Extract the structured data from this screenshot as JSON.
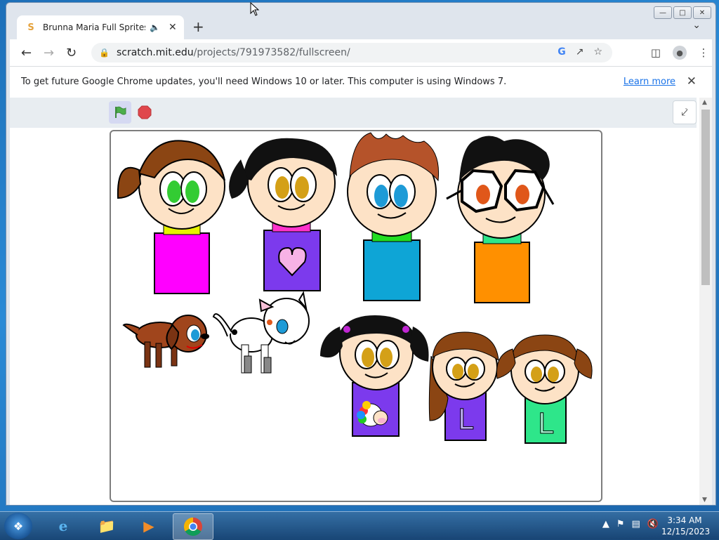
{
  "browser": {
    "tab_title": "Brunna Maria Full Sprites on Scratch",
    "new_tab_glyph": "+",
    "url_host": "scratch.mit.edu",
    "url_path": "/projects/791973582/fullscreen/",
    "infobar_message": "To get future Google Chrome updates, you'll need Windows 10 or later. This computer is using Windows 7.",
    "infobar_link": "Learn more"
  },
  "taskbar": {
    "time": "3:34 AM",
    "date": "12/15/2023"
  },
  "scratch": {
    "sprite_letters": [
      "L",
      "L"
    ]
  },
  "colors": {
    "accent_link": "#1a73e8",
    "flag_green": "#4cae4c",
    "stop_red": "#e0474c"
  }
}
